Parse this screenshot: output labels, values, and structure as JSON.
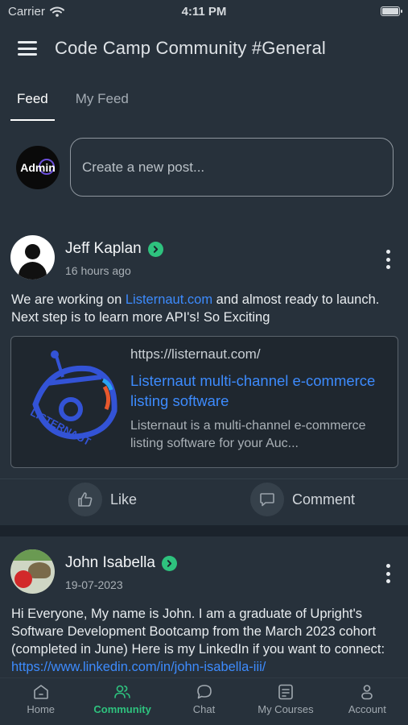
{
  "status_bar": {
    "carrier": "Carrier",
    "time": "4:11 PM"
  },
  "header": {
    "title": "Code Camp Community #General"
  },
  "tabs": [
    {
      "label": "Feed",
      "active": true
    },
    {
      "label": "My Feed",
      "active": false
    }
  ],
  "composer": {
    "avatar_text": "Admin",
    "placeholder": "Create a new post..."
  },
  "posts": [
    {
      "author": "Jeff Kaplan",
      "time": "16 hours ago",
      "text_before": "We are working on ",
      "link_text": "Listernaut.com",
      "text_after": " and almost ready to launch. Next step is to learn more API's! So Exciting",
      "preview": {
        "logo_text": "LISTERNAUT",
        "url": "https://listernaut.com/",
        "title": "Listernaut multi-channel e-commerce listing software",
        "description": "Listernaut is a multi-channel e-commerce listing software for your Auc..."
      },
      "like_label": "Like",
      "comment_label": "Comment"
    },
    {
      "author": "John Isabella",
      "time": "19-07-2023",
      "text_before": "Hi Everyone,  My name is John.  I am a graduate of Upright's Software Development Bootcamp from the March 2023 cohort (completed in June)  Here is my LinkedIn if you want to connect: ",
      "link_text": "https://www.linkedin.com/in/john-isabella-iii/"
    }
  ],
  "tab_bar": [
    {
      "label": "Home",
      "icon": "home-icon",
      "active": false
    },
    {
      "label": "Community",
      "icon": "community-icon",
      "active": true
    },
    {
      "label": "Chat",
      "icon": "chat-icon",
      "active": false
    },
    {
      "label": "My Courses",
      "icon": "courses-icon",
      "active": false
    },
    {
      "label": "Account",
      "icon": "account-icon",
      "active": false
    }
  ],
  "colors": {
    "accent": "#2ec27e",
    "link": "#3d8bfd",
    "background": "#1b232c",
    "card": "#27313b"
  }
}
